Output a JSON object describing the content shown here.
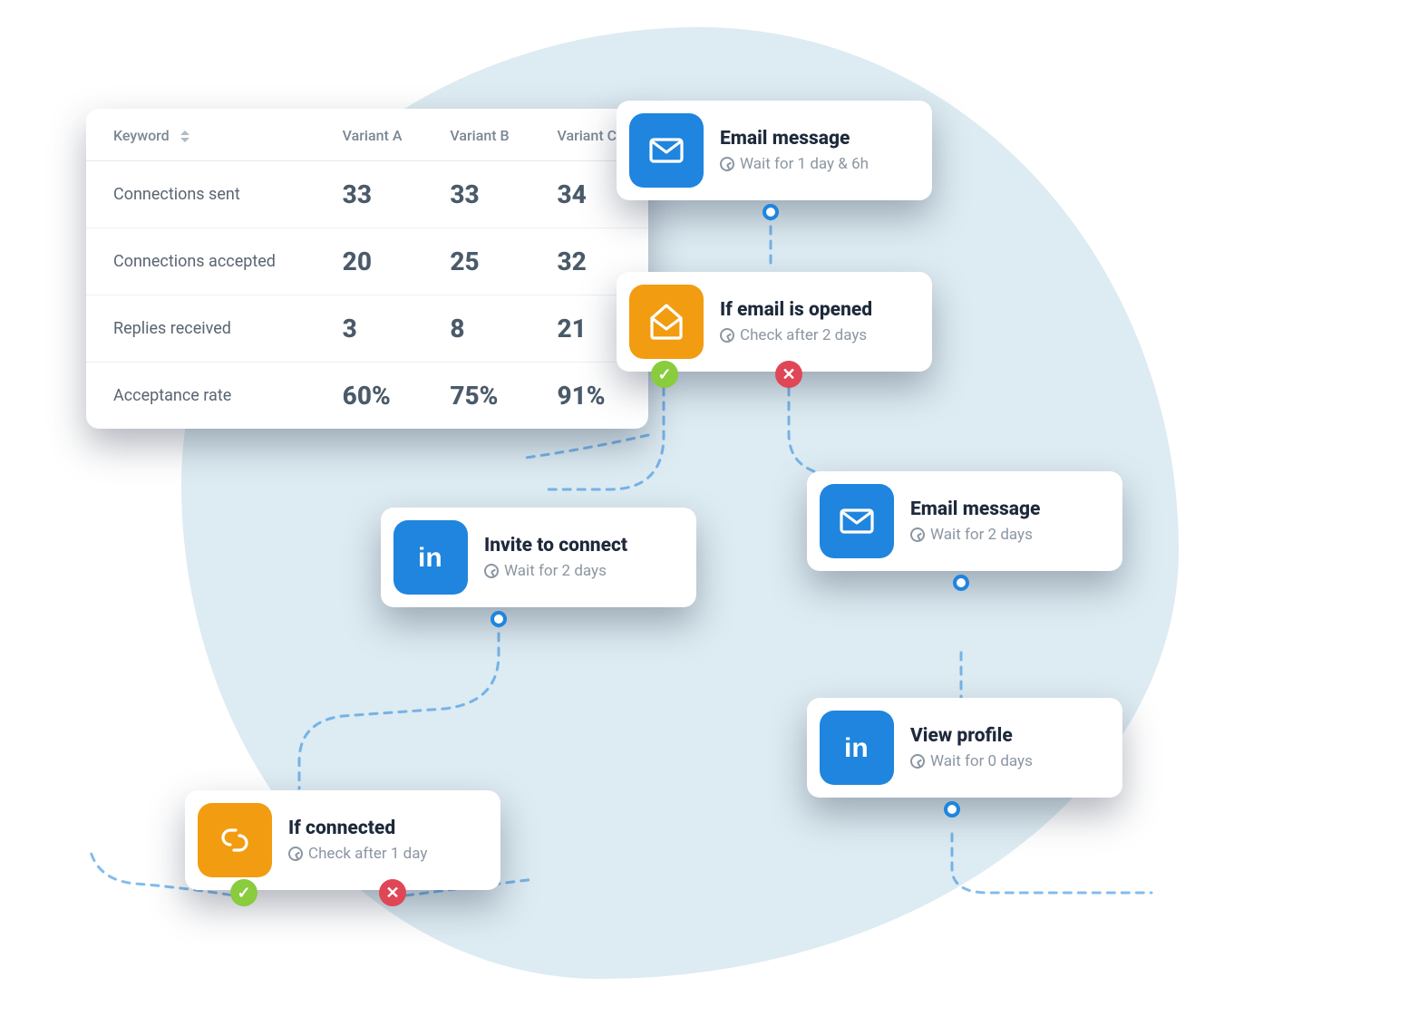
{
  "table": {
    "header": {
      "kw": "Keyword",
      "a": "Variant A",
      "b": "Variant B",
      "c": "Variant C"
    },
    "rows": [
      {
        "label": "Connections sent",
        "a": "33",
        "b": "33",
        "c": "34",
        "color": "c-green"
      },
      {
        "label": "Connections accepted",
        "a": "20",
        "b": "25",
        "c": "32",
        "color": "c-dark"
      },
      {
        "label": "Replies received",
        "a": "3",
        "b": "8",
        "c": "21",
        "color": "c-orange"
      },
      {
        "label": "Acceptance rate",
        "a": "60%",
        "b": "75%",
        "c": "91%",
        "color": "c-red"
      }
    ]
  },
  "nodes": {
    "email1": {
      "title": "Email message",
      "sub": "Wait for 1 day & 6h"
    },
    "opened": {
      "title": "If email is opened",
      "sub": "Check after 2 days"
    },
    "invite": {
      "title": "Invite to connect",
      "sub": "Wait for 2 days"
    },
    "email2": {
      "title": "Email message",
      "sub": "Wait for 2 days"
    },
    "connected": {
      "title": "If connected",
      "sub": "Check after 1 day"
    },
    "profile": {
      "title": "View profile",
      "sub": "Wait for 0 days"
    }
  }
}
